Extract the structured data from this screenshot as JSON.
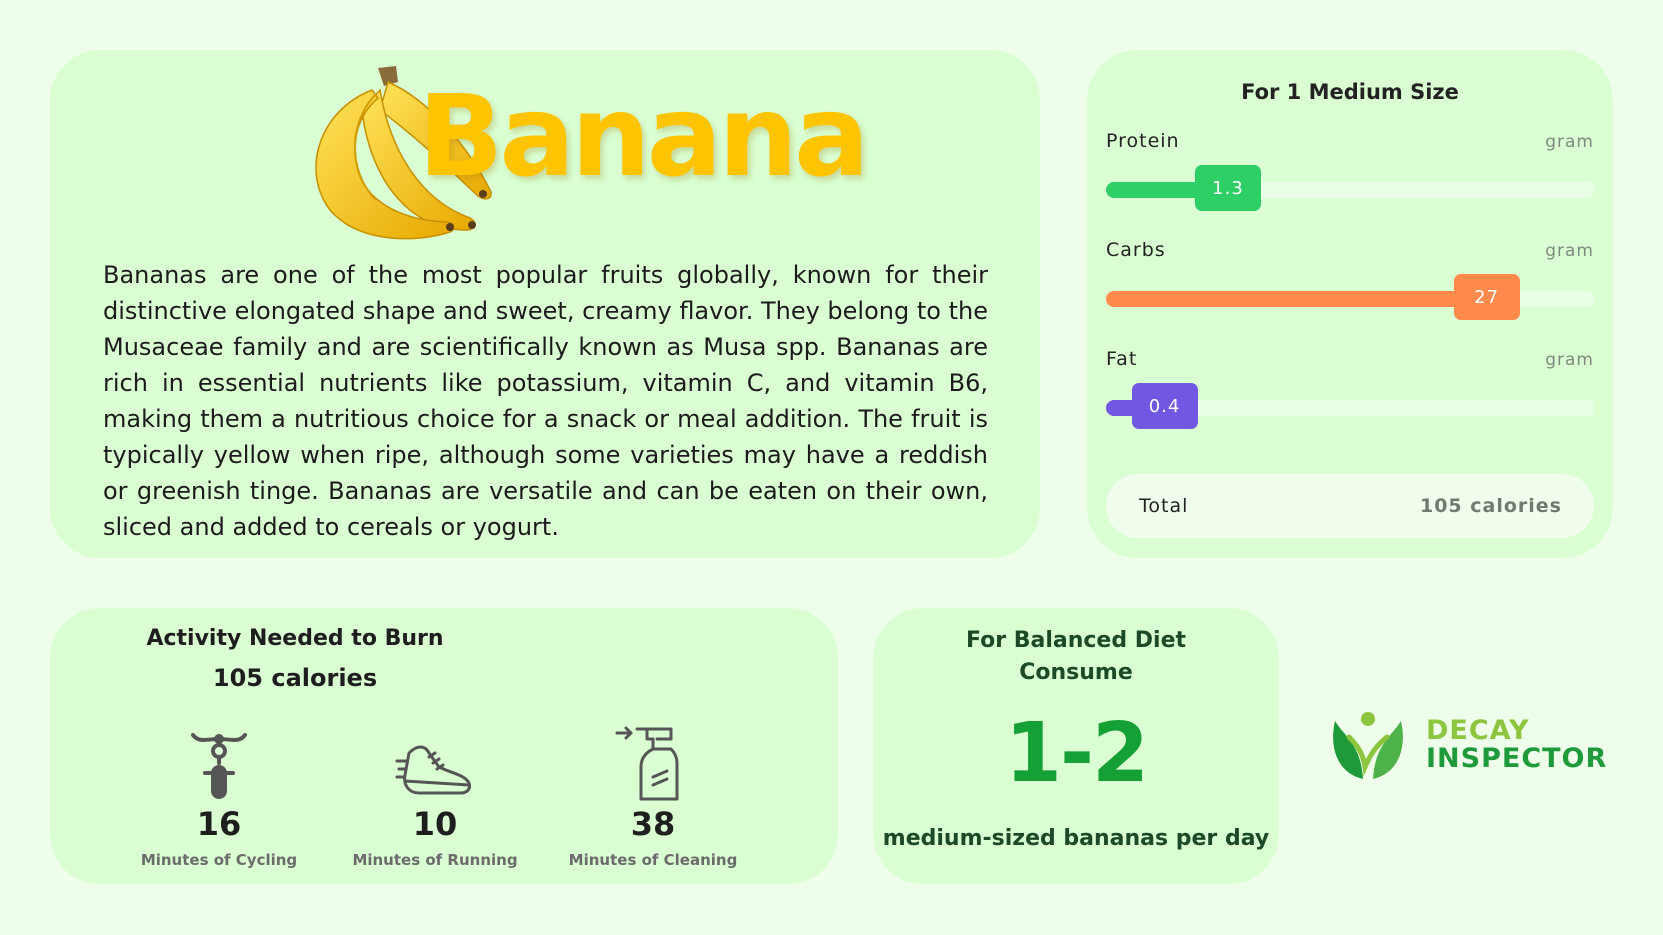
{
  "banana": {
    "title": "Banana",
    "description": "Bananas are one of the most popular fruits globally, known for their distinctive elongated shape and sweet, creamy flavor. They belong to the Musaceae family and are scientifically known as Musa spp. Bananas are rich in essential nutrients like potassium, vitamin C, and vitamin B6, making them a nutritious choice for a snack or meal addition. The fruit is typically yellow when ripe, although some varieties may have a reddish or greenish tinge. Bananas are versatile and can be eaten on their own, sliced and added to cereals or yogurt."
  },
  "nutrition": {
    "heading": "For 1 Medium Size",
    "nutrients": [
      {
        "name": "Protein",
        "unit": "gram",
        "value": "1.3",
        "fill_fraction": 0.25,
        "color": "#2fcf67"
      },
      {
        "name": "Carbs",
        "unit": "gram",
        "value": "27",
        "fill_fraction": 0.78,
        "color": "#ff8a4c"
      },
      {
        "name": "Fat",
        "unit": "gram",
        "value": "0.4",
        "fill_fraction": 0.12,
        "color": "#7157e2"
      }
    ],
    "total_label": "Total",
    "total_value": "105 calories"
  },
  "activity": {
    "title": "Activity Needed to Burn",
    "calories": "105 calories",
    "items": [
      {
        "icon": "bicycle-icon",
        "value": "16",
        "label": "Minutes of Cycling"
      },
      {
        "icon": "running-shoe-icon",
        "value": "10",
        "label": "Minutes of Running"
      },
      {
        "icon": "spray-bottle-icon",
        "value": "38",
        "label": "Minutes of Cleaning"
      }
    ]
  },
  "diet": {
    "title_line1": "For Balanced Diet",
    "title_line2": "Consume",
    "value": "1-2",
    "subtitle": "medium-sized bananas per day"
  },
  "logo": {
    "line1": "DECAY",
    "line2": "INSPECTOR"
  },
  "colors": {
    "background": "#effeeb",
    "card": "#d9ffd2",
    "banana_yellow": "#ffc400",
    "accent_green": "#15a035"
  }
}
